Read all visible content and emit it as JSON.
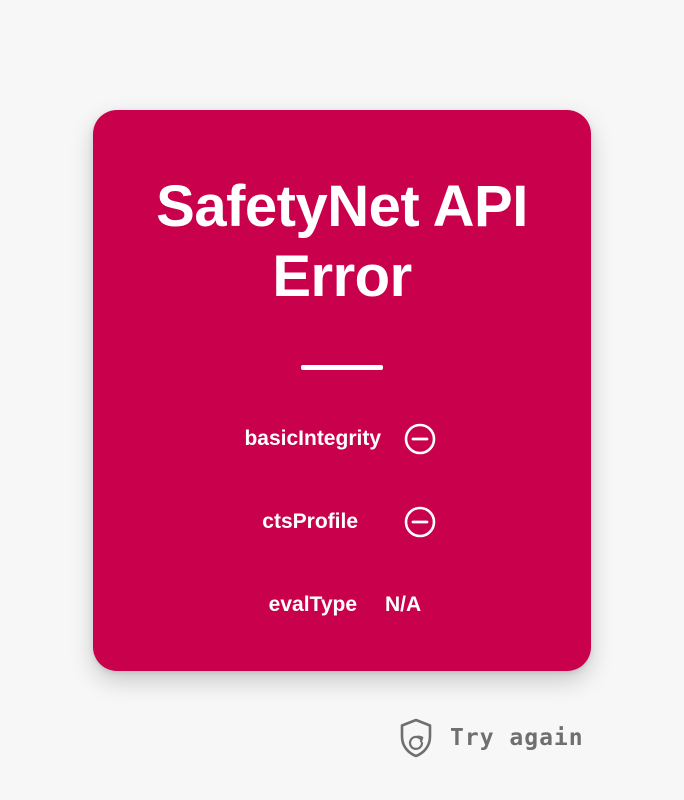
{
  "card": {
    "title": "SafetyNet API Error",
    "background_color": "#c9004b",
    "rows": [
      {
        "label": "basicIntegrity",
        "status_icon": "minus-circle-icon"
      },
      {
        "label": "ctsProfile",
        "status_icon": "minus-circle-icon"
      },
      {
        "label": "evalType",
        "value": "N/A"
      }
    ]
  },
  "action": {
    "label": "Try again",
    "icon": "shield-refresh-icon",
    "color": "#6f6f6f"
  },
  "page_background": "#f7f7f7"
}
